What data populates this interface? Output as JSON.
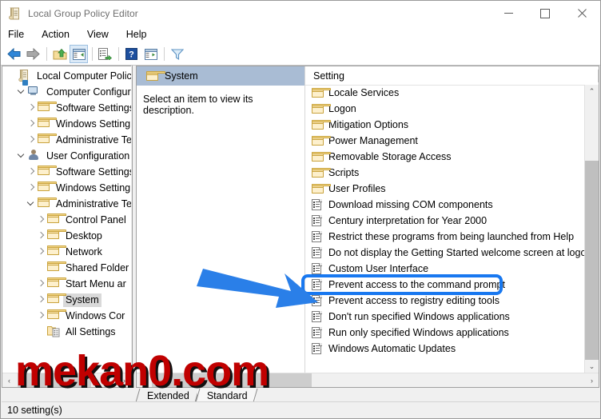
{
  "window": {
    "title": "Local Group Policy Editor",
    "title_icon": "policy-scroll-icon",
    "controls": {
      "minimize": "—",
      "maximize": "□",
      "close": "✕"
    }
  },
  "menubar": {
    "items": [
      "File",
      "Action",
      "View",
      "Help"
    ]
  },
  "toolbar": {
    "buttons": [
      {
        "name": "back-icon",
        "type": "sep0"
      },
      {
        "name": "forward-icon",
        "type": "sep0"
      },
      {
        "name": "up-folder-icon",
        "type": "sep0"
      },
      {
        "name": "show-hide-console-tree-icon",
        "type": "sep0"
      },
      {
        "name": "export-list-icon",
        "type": "sep0"
      },
      {
        "name": "help-icon",
        "type": "sep0"
      },
      {
        "name": "properties-icon",
        "type": "sep0"
      },
      {
        "name": "filter-icon",
        "type": "sep0"
      }
    ]
  },
  "tree": {
    "items": [
      {
        "label": "Local Computer Policy",
        "indent": 0,
        "chev": "none",
        "icon": "policy-scroll-icon",
        "selected": false
      },
      {
        "label": "Computer Configura",
        "indent": 1,
        "chev": "open",
        "icon": "computer-icon",
        "selected": false
      },
      {
        "label": "Software Settings",
        "indent": 2,
        "chev": "closed",
        "icon": "folder-icon",
        "selected": false
      },
      {
        "label": "Windows Setting",
        "indent": 2,
        "chev": "closed",
        "icon": "folder-icon",
        "selected": false
      },
      {
        "label": "Administrative Te",
        "indent": 2,
        "chev": "closed",
        "icon": "folder-icon",
        "selected": false
      },
      {
        "label": "User Configuration",
        "indent": 1,
        "chev": "open",
        "icon": "user-icon",
        "selected": false
      },
      {
        "label": "Software Settings",
        "indent": 2,
        "chev": "closed",
        "icon": "folder-icon",
        "selected": false
      },
      {
        "label": "Windows Setting",
        "indent": 2,
        "chev": "closed",
        "icon": "folder-icon",
        "selected": false
      },
      {
        "label": "Administrative Te",
        "indent": 2,
        "chev": "open",
        "icon": "folder-icon",
        "selected": false
      },
      {
        "label": "Control Panel",
        "indent": 3,
        "chev": "closed",
        "icon": "folder-icon",
        "selected": false
      },
      {
        "label": "Desktop",
        "indent": 3,
        "chev": "closed",
        "icon": "folder-icon",
        "selected": false
      },
      {
        "label": "Network",
        "indent": 3,
        "chev": "closed",
        "icon": "folder-icon",
        "selected": false
      },
      {
        "label": "Shared Folder",
        "indent": 3,
        "chev": "none",
        "icon": "folder-icon",
        "selected": false
      },
      {
        "label": "Start Menu ar",
        "indent": 3,
        "chev": "closed",
        "icon": "folder-icon",
        "selected": false
      },
      {
        "label": "System",
        "indent": 3,
        "chev": "closed",
        "icon": "folder-icon",
        "selected": true
      },
      {
        "label": "Windows Cor",
        "indent": 3,
        "chev": "closed",
        "icon": "folder-icon",
        "selected": false
      },
      {
        "label": "All Settings",
        "indent": 3,
        "chev": "none",
        "icon": "all-settings-icon",
        "selected": false
      }
    ]
  },
  "description": {
    "header_title": "System",
    "header_icon": "folder-icon",
    "text": "Select an item to view its description."
  },
  "list": {
    "column_header": "Setting",
    "rows": [
      {
        "label": "Locale Services",
        "icon": "folder-icon"
      },
      {
        "label": "Logon",
        "icon": "folder-icon"
      },
      {
        "label": "Mitigation Options",
        "icon": "folder-icon"
      },
      {
        "label": "Power Management",
        "icon": "folder-icon"
      },
      {
        "label": "Removable Storage Access",
        "icon": "folder-icon"
      },
      {
        "label": "Scripts",
        "icon": "folder-icon"
      },
      {
        "label": "User Profiles",
        "icon": "folder-icon"
      },
      {
        "label": "Download missing COM components",
        "icon": "policy-setting-icon"
      },
      {
        "label": "Century interpretation for Year 2000",
        "icon": "policy-setting-icon"
      },
      {
        "label": "Restrict these programs from being launched from Help",
        "icon": "policy-setting-icon"
      },
      {
        "label": "Do not display the Getting Started welcome screen at logon",
        "icon": "policy-setting-icon"
      },
      {
        "label": "Custom User Interface",
        "icon": "policy-setting-icon"
      },
      {
        "label": "Prevent access to the command prompt",
        "icon": "policy-setting-icon"
      },
      {
        "label": "Prevent access to registry editing tools",
        "icon": "policy-setting-icon"
      },
      {
        "label": "Don't run specified Windows applications",
        "icon": "policy-setting-icon"
      },
      {
        "label": "Run only specified Windows applications",
        "icon": "policy-setting-icon"
      },
      {
        "label": "Windows Automatic Updates",
        "icon": "policy-setting-icon"
      }
    ]
  },
  "scrollbars": {
    "up_arrow": "⌃",
    "down_arrow": "⌄",
    "left_arrow": "‹",
    "right_arrow": "›"
  },
  "tabs": {
    "items": [
      "Extended",
      "Standard"
    ],
    "active": "Standard"
  },
  "statusbar": {
    "text": "10 setting(s)"
  },
  "annotations": {
    "highlight_target": "Prevent access to the command prompt",
    "box_color": "#1878f0",
    "arrow_color": "#2a7fe8",
    "watermark": "mekan0.com",
    "watermark_color": "#c00000"
  }
}
